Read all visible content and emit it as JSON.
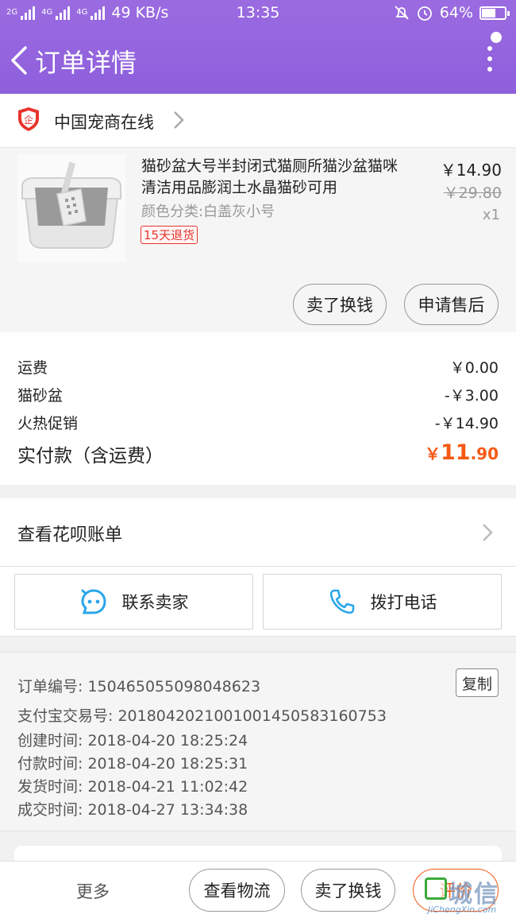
{
  "status_bar": {
    "network_1": "2G",
    "network_2": "4G",
    "network_3": "4G",
    "speed": "49 KB/s",
    "time": "13:35",
    "battery": "64%",
    "battery_level": 0.64
  },
  "nav": {
    "title": "订单详情"
  },
  "store": {
    "name": "中国宠商在线",
    "icon_text": "企"
  },
  "item": {
    "title": "猫砂盆大号半封闭式猫厕所猫沙盆猫咪清洁用品膨润土水晶猫砂可用",
    "spec": "颜色分类:白盖灰小号",
    "refund_badge": "15天退货",
    "price": "￥14.90",
    "original_price": "￥29.80",
    "quantity": "x1",
    "sell_button": "卖了换钱",
    "after_sale_button": "申请售后"
  },
  "summary": {
    "rows": [
      {
        "label": "运费",
        "value": "￥0.00"
      },
      {
        "label": "猫砂盆",
        "value": "-￥3.00"
      },
      {
        "label": "火热促销",
        "value": "-￥14.90"
      }
    ],
    "total_label": "实付款（含运费）",
    "total_currency": "￥",
    "total_integer": "11",
    "total_decimal": ".90"
  },
  "huabei": {
    "label": "查看花呗账单"
  },
  "contact": {
    "seller_button": "联系卖家",
    "call_button": "拨打电话"
  },
  "order_info": {
    "order_no": "订单编号: 150465055098048623",
    "alipay_no": "支付宝交易号: 2018042021001001450583160753",
    "created": "创建时间: 2018-04-20 18:25:24",
    "paid": "付款时间: 2018-04-20 18:25:31",
    "shipped": "发货时间: 2018-04-21 11:02:42",
    "completed": "成交时间: 2018-04-27 13:34:38",
    "copy_button": "复制"
  },
  "bottom_bar": {
    "more": "更多",
    "logistics_button": "查看物流",
    "sell_button": "卖了换钱",
    "rate_button": "评价"
  },
  "watermark": {
    "text": "城信",
    "url": "JiChengXin.com"
  },
  "colors": {
    "header": "#9a6be0",
    "accent": "#f55a14",
    "badge_red": "#e8342c",
    "contact_icon": "#2aa6ea"
  },
  "icons": [
    "back-arrow-icon",
    "more-vertical-icon",
    "store-shield-icon",
    "chevron-right-icon",
    "chat-bubble-icon",
    "phone-icon"
  ]
}
